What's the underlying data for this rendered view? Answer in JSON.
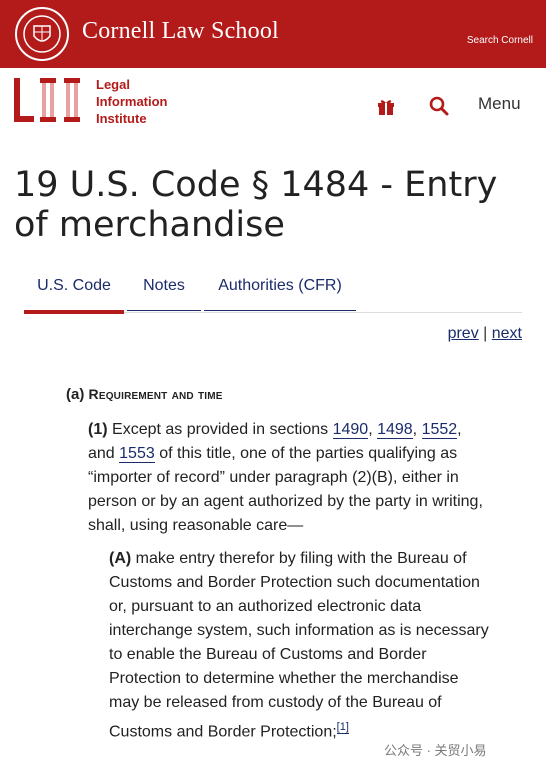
{
  "header": {
    "brand": "Cornell Law School",
    "search_link": "Search Cornell",
    "seal_text": "CORNELL UNIVERSITY FOUNDED A.D. 1865"
  },
  "lii": {
    "logo_letters": "LII",
    "name_line1": "Legal",
    "name_line2": "Information",
    "name_line3": "Institute",
    "menu_label": "Menu"
  },
  "page": {
    "title": "19 U.S. Code § 1484 - Entry of merchandise"
  },
  "tabs": [
    {
      "label": "U.S. Code",
      "active": true
    },
    {
      "label": "Notes",
      "active": false
    },
    {
      "label": "Authorities (CFR)",
      "active": false
    }
  ],
  "pager": {
    "prev": "prev",
    "separator": "|",
    "next": "next"
  },
  "section": {
    "a_label": "(a)",
    "a_heading": "Requirement and time",
    "p1_label": "(1)",
    "p1_text_1": "Except as provided in sections",
    "p1_link_1": "1490",
    "p1_link_2": "1498",
    "p1_link_3": "1552",
    "p1_text_2": ", and",
    "p1_link_4": "1553",
    "p1_text_3": "of this title, one of the parties qualifying as “importer of record” under paragraph (2)(B), either in person or by an agent authorized by the party in writing, shall, using reasonable care—",
    "pA_label": "(A)",
    "pA_text": "make entry therefor by filing with the Bureau of Customs and Border Protection such documentation or, pursuant to an authorized electronic data interchange system, such information as is necessary to enable the Bureau of Customs and Border Protection to determine whether the merchandise may be released from custody of the Bureau of Customs and Border Protection;",
    "pA_footnote": "[1]"
  },
  "watermark": "公众号 · 关贸小易",
  "colors": {
    "cornell_red": "#b31b1b",
    "link_blue": "#1b2c6b"
  }
}
